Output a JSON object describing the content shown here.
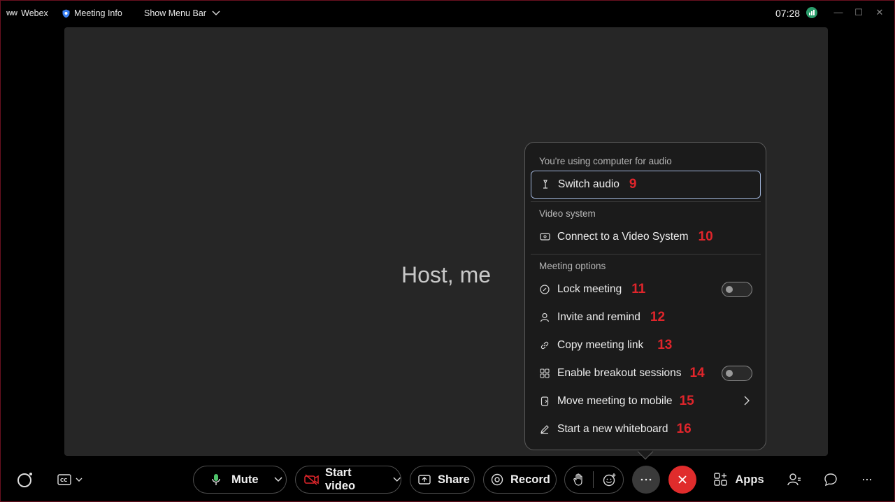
{
  "titlebar": {
    "app_name": "Webex",
    "meeting_info": "Meeting Info",
    "show_menu_bar": "Show Menu Bar",
    "clock": "07:28"
  },
  "stage": {
    "participant_name": "Host, me"
  },
  "menu": {
    "audio_section_label": "You're using computer for audio",
    "switch_audio": {
      "label": "Switch audio",
      "num": "9"
    },
    "video_section_label": "Video system",
    "connect_video": {
      "label": "Connect to a Video System",
      "num": "10"
    },
    "options_section_label": "Meeting options",
    "lock_meeting": {
      "label": "Lock meeting",
      "num": "11",
      "toggle_on": false
    },
    "invite_remind": {
      "label": "Invite and remind",
      "num": "12"
    },
    "copy_link": {
      "label": "Copy meeting link",
      "num": "13"
    },
    "breakout": {
      "label": "Enable breakout sessions",
      "num": "14",
      "toggle_on": false
    },
    "move_mobile": {
      "label": "Move meeting to mobile",
      "num": "15"
    },
    "whiteboard": {
      "label": "Start a new whiteboard",
      "num": "16"
    }
  },
  "bottombar": {
    "mute": "Mute",
    "start_video": "Start video",
    "share": "Share",
    "record": "Record",
    "apps": "Apps"
  },
  "colors": {
    "accent_red": "#e0252b",
    "end_call_red": "#e02c2c",
    "status_green": "#2a9d6b"
  }
}
